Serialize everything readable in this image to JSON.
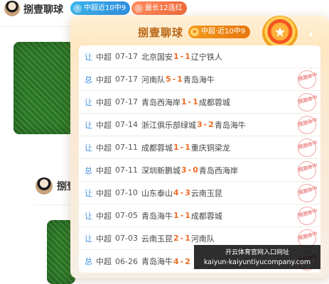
{
  "post1": {
    "author": "捌壹聊球",
    "pills": [
      {
        "icon": "lightning-icon",
        "label": "中超近10中9",
        "color": "#3ab3ec"
      },
      {
        "icon": "flame-icon",
        "label": "最长12连红",
        "color": "#f06a3a"
      }
    ]
  },
  "post2": {
    "author": "捌壹"
  },
  "popup": {
    "title": "捌壹聊球",
    "badge": "中超·近10中9",
    "rows": [
      {
        "tag": "让",
        "league": "中超",
        "date": "07-17",
        "home": "北京国安",
        "hs": "1",
        "as": "1",
        "away": "辽宁铁人",
        "stamp": ""
      },
      {
        "tag": "总",
        "league": "中超",
        "date": "07-17",
        "home": "河南队",
        "hs": "5",
        "as": "1",
        "away": "青岛海牛",
        "stamp": "预测命中"
      },
      {
        "tag": "让",
        "league": "中超",
        "date": "07-17",
        "home": "青岛西海岸",
        "hs": "1",
        "as": "1",
        "away": "成都蓉城",
        "stamp": "预测命中"
      },
      {
        "tag": "让",
        "league": "中超",
        "date": "07-14",
        "home": "浙江俱乐部绿城",
        "hs": "3",
        "as": "2",
        "away": "青岛海牛",
        "stamp": "预测命中"
      },
      {
        "tag": "让",
        "league": "中超",
        "date": "07-11",
        "home": "成都蓉城",
        "hs": "1",
        "as": "1",
        "away": "重庆铜梁龙",
        "stamp": "预测命中"
      },
      {
        "tag": "总",
        "league": "中超",
        "date": "07-11",
        "home": "深圳新鹏城",
        "hs": "3",
        "as": "0",
        "away": "青岛西海岸",
        "stamp": "预测命中"
      },
      {
        "tag": "让",
        "league": "中超",
        "date": "07-10",
        "home": "山东泰山",
        "hs": "4",
        "as": "3",
        "away": "云南玉昆",
        "stamp": "预测命中"
      },
      {
        "tag": "让",
        "league": "中超",
        "date": "07-05",
        "home": "青岛海牛",
        "hs": "1",
        "as": "1",
        "away": "成都蓉城",
        "stamp": "预测命中"
      },
      {
        "tag": "让",
        "league": "中超",
        "date": "07-03",
        "home": "云南玉昆",
        "hs": "2",
        "as": "1",
        "away": "河南队",
        "stamp": "预测命中"
      },
      {
        "tag": "总",
        "league": "中超",
        "date": "06-26",
        "home": "青岛海牛",
        "hs": "4",
        "as": "2",
        "away": "",
        "stamp": "预测命中"
      }
    ]
  },
  "watermark": {
    "line1": "开云体育官网入口网址",
    "line2": "kaiyun-kaiyuntiyucompany.com"
  },
  "colors": {
    "accent": "#ee6a25",
    "tag": "#3b8fe0",
    "title": "#b86616",
    "stamp": "#ec8c8c"
  }
}
